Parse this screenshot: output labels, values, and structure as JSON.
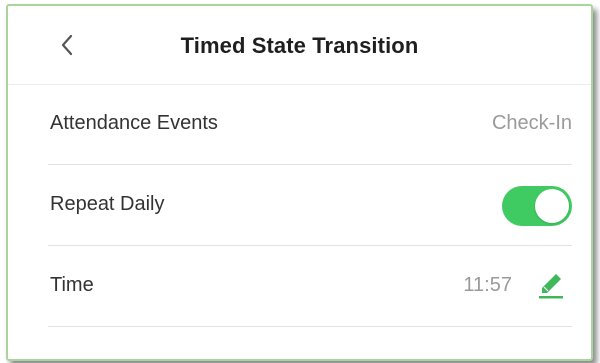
{
  "header": {
    "title": "Timed State Transition",
    "back_icon": "chevron-left-icon"
  },
  "rows": [
    {
      "label": "Attendance Events",
      "value": "Check-In"
    },
    {
      "label": "Repeat Daily",
      "toggle_on": true
    },
    {
      "label": "Time",
      "value": "11:57",
      "edit_icon": "pencil-icon"
    }
  ],
  "colors": {
    "accent": "#3fca62",
    "frame_border": "#a9d59a",
    "value_text": "#9a9a9a"
  }
}
